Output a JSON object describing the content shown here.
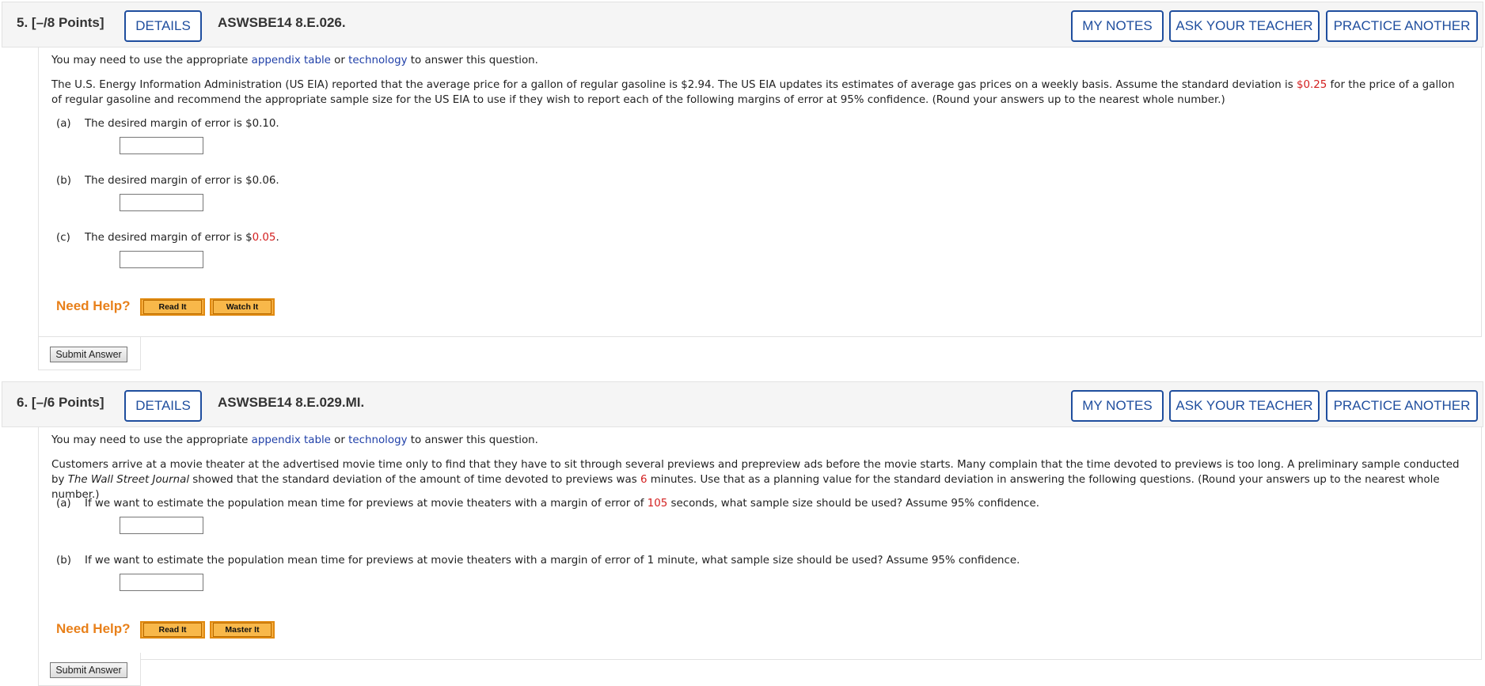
{
  "questions": [
    {
      "number": "5.",
      "points": "[–/8 Points]",
      "details_label": "DETAILS",
      "id": "ASWSBE14 8.E.026.",
      "my_notes_label": "MY NOTES",
      "ask_teacher_label": "ASK YOUR TEACHER",
      "practice_label": "PRACTICE ANOTHER",
      "intro_pre": "You may need to use the appropriate ",
      "intro_link1": "appendix table",
      "intro_or": " or ",
      "intro_link2": "technology",
      "intro_post": " to answer this question.",
      "stem_a": "The U.S. Energy Information Administration (US EIA) reported that the average price for a gallon of regular gasoline is $2.94. The US EIA updates its estimates of average gas prices on a weekly basis. Assume the standard deviation is ",
      "stem_red": "$0.25",
      "stem_b": " for the price of a gallon of regular gasoline and recommend the appropriate sample size for the US EIA to use if they wish to report each of the following margins of error at 95% confidence. (Round your answers up to the nearest whole number.)",
      "parts": [
        {
          "label": "(a)",
          "pre": "The desired margin of error is $0.10.",
          "red": "",
          "post": "",
          "value": ""
        },
        {
          "label": "(b)",
          "pre": "The desired margin of error is $0.06.",
          "red": "",
          "post": "",
          "value": ""
        },
        {
          "label": "(c)",
          "pre": "The desired margin of error is $",
          "red": "0.05",
          "post": ".",
          "value": ""
        }
      ],
      "need_help": "Need Help?",
      "help_buttons": [
        "Read It",
        "Watch It"
      ],
      "submit_label": "Submit Answer"
    },
    {
      "number": "6.",
      "points": "[–/6 Points]",
      "details_label": "DETAILS",
      "id": "ASWSBE14 8.E.029.MI.",
      "my_notes_label": "MY NOTES",
      "ask_teacher_label": "ASK YOUR TEACHER",
      "practice_label": "PRACTICE ANOTHER",
      "intro_pre": "You may need to use the appropriate ",
      "intro_link1": "appendix table",
      "intro_or": " or ",
      "intro_link2": "technology",
      "intro_post": " to answer this question.",
      "stem_a": "Customers arrive at a movie theater at the advertised movie time only to find that they have to sit through several previews and prepreview ads before the movie starts. Many complain that the time devoted to previews is too long. A preliminary sample conducted by ",
      "stem_italic": "The Wall Street Journal",
      "stem_b": " showed that the standard deviation of the amount of time devoted to previews was ",
      "stem_red": "6",
      "stem_c": " minutes. Use that as a planning value for the standard deviation in answering the following questions. (Round your answers up to the nearest whole number.)",
      "parts": [
        {
          "label": "(a)",
          "pre": "If we want to estimate the population mean time for previews at movie theaters with a margin of error of ",
          "red": "105",
          "post": " seconds, what sample size should be used? Assume 95% confidence.",
          "value": ""
        },
        {
          "label": "(b)",
          "pre": "If we want to estimate the population mean time for previews at movie theaters with a margin of error of 1 minute, what sample size should be used? Assume 95% confidence.",
          "red": "",
          "post": "",
          "value": ""
        }
      ],
      "need_help": "Need Help?",
      "help_buttons": [
        "Read It",
        "Master It"
      ],
      "submit_label": "Submit Answer"
    }
  ]
}
